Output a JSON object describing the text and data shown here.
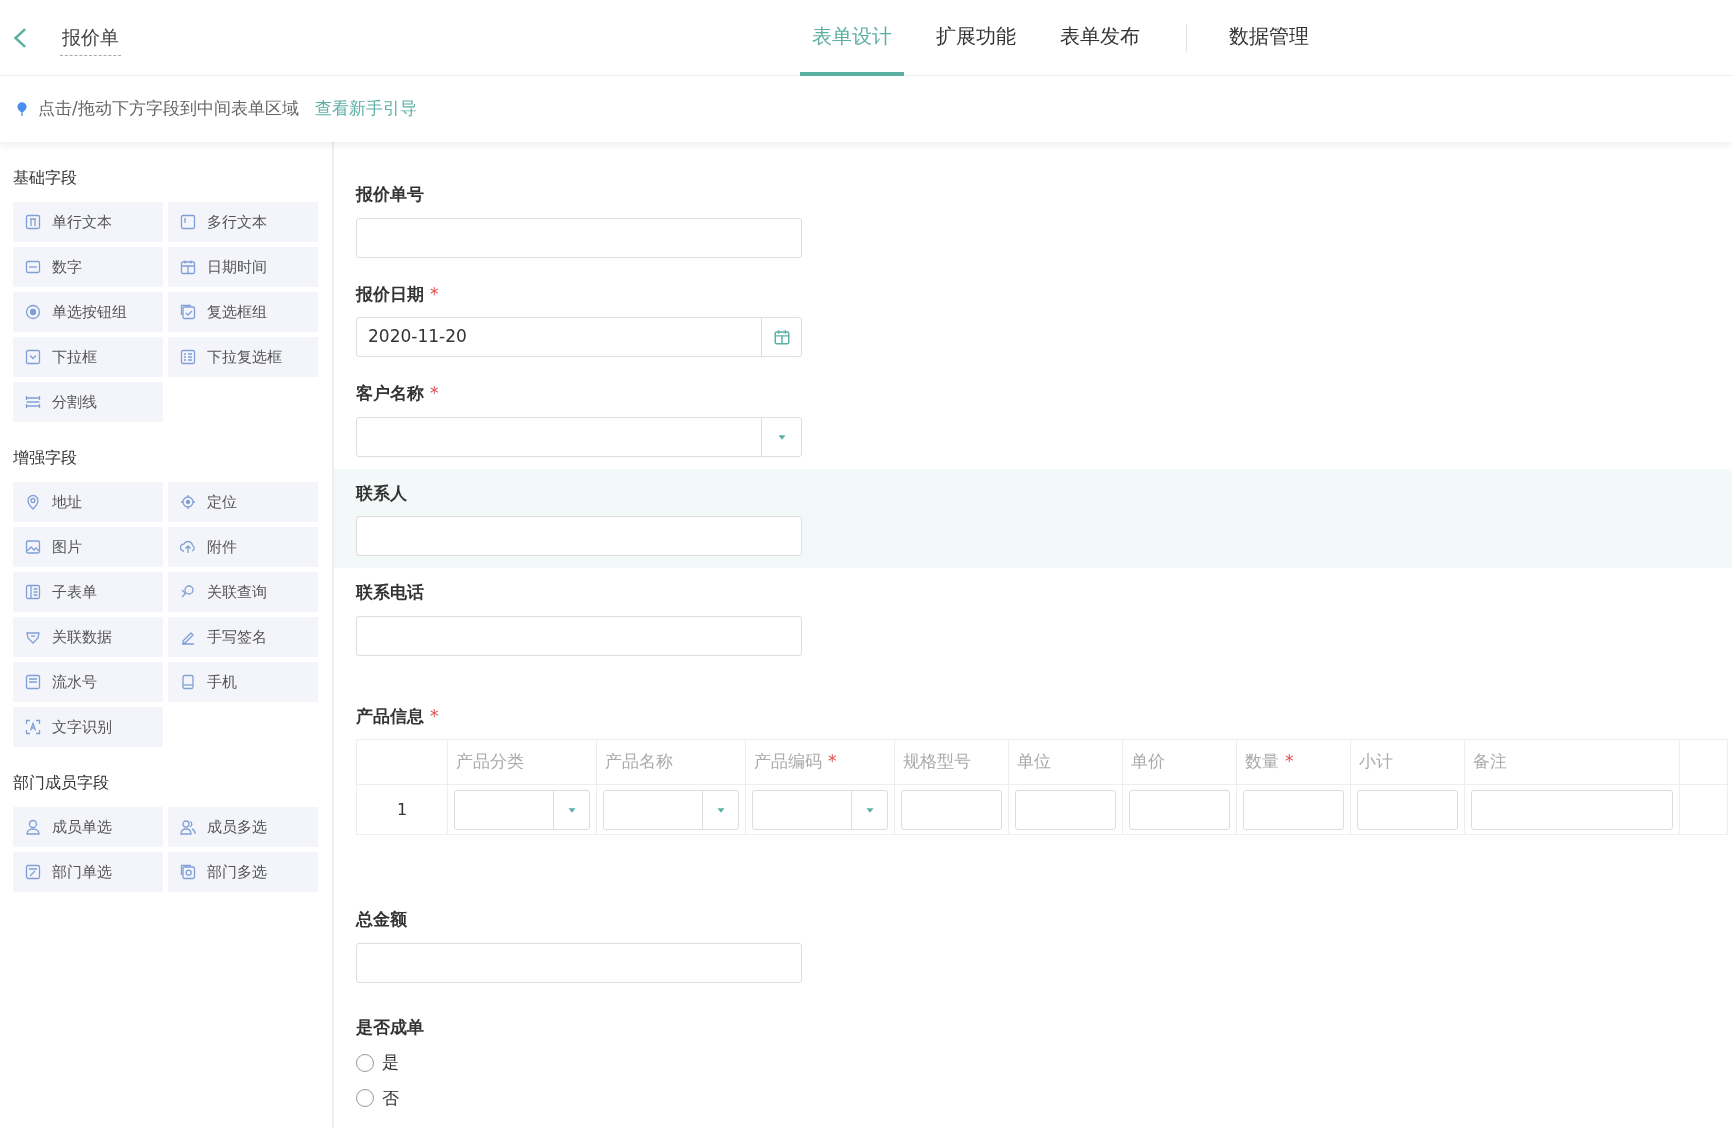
{
  "header": {
    "title": "报价单",
    "tabs": [
      {
        "label": "表单设计",
        "selected": true
      },
      {
        "label": "扩展功能",
        "selected": false
      },
      {
        "label": "表单发布",
        "selected": false
      },
      {
        "label": "数据管理",
        "selected": false
      }
    ]
  },
  "hint": {
    "text": "点击/拖动下方字段到中间表单区域",
    "link": "查看新手引导"
  },
  "palette": [
    {
      "title": "基础字段",
      "items": [
        {
          "label": "单行文本",
          "kind": "text"
        },
        {
          "label": "多行文本",
          "kind": "textarea"
        },
        {
          "label": "数字",
          "kind": "number"
        },
        {
          "label": "日期时间",
          "kind": "datetime"
        },
        {
          "label": "单选按钮组",
          "kind": "radio"
        },
        {
          "label": "复选框组",
          "kind": "checkbox"
        },
        {
          "label": "下拉框",
          "kind": "select"
        },
        {
          "label": "下拉复选框",
          "kind": "multiselect"
        },
        {
          "label": "分割线",
          "kind": "divider"
        }
      ]
    },
    {
      "title": "增强字段",
      "items": [
        {
          "label": "地址",
          "kind": "address"
        },
        {
          "label": "定位",
          "kind": "location"
        },
        {
          "label": "图片",
          "kind": "image"
        },
        {
          "label": "附件",
          "kind": "upload"
        },
        {
          "label": "子表单",
          "kind": "subform"
        },
        {
          "label": "关联查询",
          "kind": "query"
        },
        {
          "label": "关联数据",
          "kind": "link"
        },
        {
          "label": "手写签名",
          "kind": "signature"
        },
        {
          "label": "流水号",
          "kind": "serial"
        },
        {
          "label": "手机",
          "kind": "phone"
        },
        {
          "label": "文字识别",
          "kind": "ocr"
        }
      ]
    },
    {
      "title": "部门成员字段",
      "items": [
        {
          "label": "成员单选",
          "kind": "member"
        },
        {
          "label": "成员多选",
          "kind": "members"
        },
        {
          "label": "部门单选",
          "kind": "dept"
        },
        {
          "label": "部门多选",
          "kind": "depts"
        }
      ]
    }
  ],
  "form": [
    {
      "kind": "text",
      "label": "报价单号",
      "highlighted": false
    },
    {
      "kind": "date",
      "label": "报价日期",
      "required_mark": "*",
      "value": "2020-11-20",
      "highlighted": false
    },
    {
      "kind": "select",
      "label": "客户名称",
      "required_mark": "*",
      "highlighted": false
    },
    {
      "kind": "text",
      "label": "联系人",
      "highlighted": true
    },
    {
      "kind": "text",
      "label": "联系电话",
      "highlighted": false
    },
    {
      "kind": "table",
      "label": "产品信息",
      "required_mark": "*",
      "highlighted": false,
      "columns": [
        {
          "label": "产品分类",
          "kind": "select"
        },
        {
          "label": "产品名称",
          "kind": "select"
        },
        {
          "label": "产品编码",
          "required_mark": "*",
          "kind": "select"
        },
        {
          "label": "规格型号",
          "kind": "input"
        },
        {
          "label": "单位",
          "kind": "input"
        },
        {
          "label": "单价",
          "kind": "input"
        },
        {
          "label": "数量",
          "required_mark": "*",
          "kind": "input"
        },
        {
          "label": "小计",
          "kind": "input"
        },
        {
          "label": "备注",
          "kind": "wide"
        }
      ],
      "rows": [
        {
          "index": "1"
        }
      ]
    },
    {
      "kind": "text",
      "label": "总金额",
      "highlighted": false
    },
    {
      "kind": "radio",
      "label": "是否成单",
      "highlighted": false,
      "options": [
        {
          "label": "是",
          "selected": false
        },
        {
          "label": "否",
          "selected": false
        }
      ]
    }
  ]
}
